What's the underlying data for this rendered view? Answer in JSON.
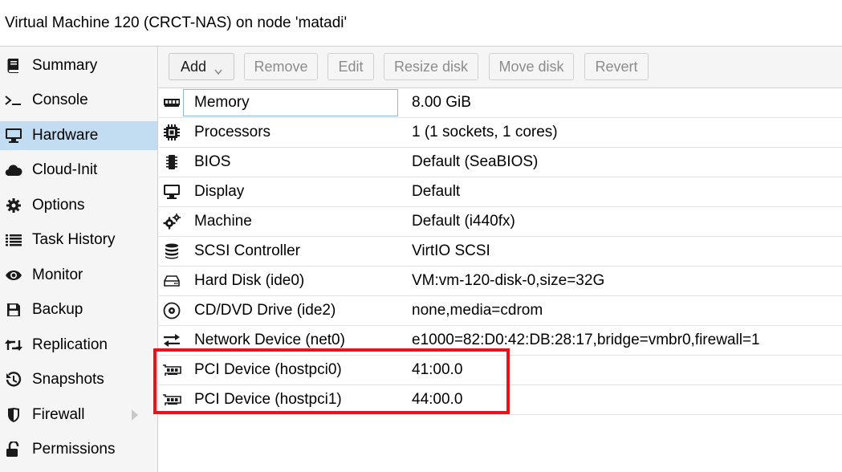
{
  "window": {
    "title": "Virtual Machine 120 (CRCT-NAS) on node 'matadi'"
  },
  "sidebar": {
    "items": [
      {
        "label": "Summary",
        "icon": "book-icon"
      },
      {
        "label": "Console",
        "icon": "terminal-icon"
      },
      {
        "label": "Hardware",
        "icon": "desktop-icon",
        "active": true
      },
      {
        "label": "Cloud-Init",
        "icon": "cloud-icon"
      },
      {
        "label": "Options",
        "icon": "gear-icon"
      },
      {
        "label": "Task History",
        "icon": "list-icon"
      },
      {
        "label": "Monitor",
        "icon": "eye-icon"
      },
      {
        "label": "Backup",
        "icon": "floppy-icon"
      },
      {
        "label": "Replication",
        "icon": "retweet-icon"
      },
      {
        "label": "Snapshots",
        "icon": "history-icon"
      },
      {
        "label": "Firewall",
        "icon": "shield-icon",
        "expandable": true
      },
      {
        "label": "Permissions",
        "icon": "unlock-icon"
      }
    ]
  },
  "toolbar": {
    "add_label": "Add",
    "remove_label": "Remove",
    "edit_label": "Edit",
    "resize_label": "Resize disk",
    "move_label": "Move disk",
    "revert_label": "Revert"
  },
  "hardware": {
    "rows": [
      {
        "name": "Memory",
        "value": "8.00 GiB",
        "icon": "memory-icon"
      },
      {
        "name": "Processors",
        "value": "1 (1 sockets, 1 cores)",
        "icon": "cpu-icon"
      },
      {
        "name": "BIOS",
        "value": "Default (SeaBIOS)",
        "icon": "microchip-icon"
      },
      {
        "name": "Display",
        "value": "Default",
        "icon": "monitor-icon"
      },
      {
        "name": "Machine",
        "value": "Default (i440fx)",
        "icon": "cogs-icon"
      },
      {
        "name": "SCSI Controller",
        "value": "VirtIO SCSI",
        "icon": "database-icon"
      },
      {
        "name": "Hard Disk (ide0)",
        "value": "VM:vm-120-disk-0,size=32G",
        "icon": "hdd-icon"
      },
      {
        "name": "CD/DVD Drive (ide2)",
        "value": "none,media=cdrom",
        "icon": "cdrom-icon"
      },
      {
        "name": "Network Device (net0)",
        "value": "e1000=82:D0:42:DB:28:17,bridge=vmbr0,firewall=1",
        "icon": "exchange-icon"
      },
      {
        "name": "PCI Device (hostpci0)",
        "value": "41:00.0",
        "icon": "pci-card-icon"
      },
      {
        "name": "PCI Device (hostpci1)",
        "value": "44:00.0",
        "icon": "pci-card-icon"
      }
    ]
  },
  "colors": {
    "active_nav": "#c2ddf2",
    "highlight_box": "#e8121a",
    "focus_border": "#8eb8dc"
  }
}
